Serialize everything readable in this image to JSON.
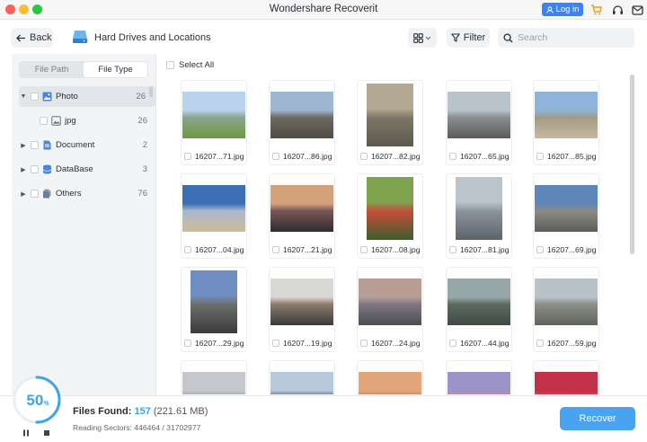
{
  "window": {
    "title": "Wondershare Recoverit",
    "login_label": "Log in"
  },
  "header": {
    "back_label": "Back",
    "location_title": "Hard Drives and Locations",
    "filter_label": "Filter",
    "search_placeholder": "Search"
  },
  "sidebar": {
    "tabs": [
      {
        "label": "File Path",
        "active": false
      },
      {
        "label": "File Type",
        "active": true
      }
    ],
    "items": [
      {
        "label": "Photo",
        "count": "26",
        "icon": "photo-icon",
        "color": "#4a86d8"
      },
      {
        "label": "jpg",
        "count": "26",
        "icon": "image-file-icon",
        "color": "#8a8f97"
      },
      {
        "label": "Document",
        "count": "2",
        "icon": "document-icon",
        "color": "#4a86d8"
      },
      {
        "label": "DataBase",
        "count": "3",
        "icon": "database-icon",
        "color": "#4a86d8"
      },
      {
        "label": "Others",
        "count": "76",
        "icon": "others-icon",
        "color": "#6b7f99"
      }
    ]
  },
  "content": {
    "select_all_label": "Select All",
    "files": [
      {
        "name": "16207...71.jpg",
        "orientation": "landscape",
        "colors": [
          "#b9d2ee",
          "#8aa58a",
          "#6c9a3f"
        ]
      },
      {
        "name": "16207...86.jpg",
        "orientation": "landscape",
        "colors": [
          "#9eb6cf",
          "#6e6a62",
          "#4f4a44"
        ]
      },
      {
        "name": "16207...82.jpg",
        "orientation": "portrait",
        "colors": [
          "#b3a892",
          "#7d7566",
          "#5e5a50"
        ]
      },
      {
        "name": "16207...65.jpg",
        "orientation": "landscape",
        "colors": [
          "#b9c3cc",
          "#8a8f93",
          "#5b5b58"
        ]
      },
      {
        "name": "16207...85.jpg",
        "orientation": "landscape",
        "colors": [
          "#8fb3d9",
          "#a39a86",
          "#c9b9a0"
        ]
      },
      {
        "name": "16207...04.jpg",
        "orientation": "landscape",
        "colors": [
          "#3a6fb3",
          "#a7b8cf",
          "#d1bb94"
        ]
      },
      {
        "name": "16207...21.jpg",
        "orientation": "landscape",
        "colors": [
          "#d4a27a",
          "#7a5757",
          "#2f2b31"
        ]
      },
      {
        "name": "16207...08.jpg",
        "orientation": "portrait",
        "colors": [
          "#7fa24f",
          "#c44c3a",
          "#3d5e2c"
        ]
      },
      {
        "name": "16207...81.jpg",
        "orientation": "portrait",
        "colors": [
          "#bcc4cb",
          "#8b939a",
          "#5d6369"
        ]
      },
      {
        "name": "16207...69.jpg",
        "orientation": "landscape",
        "colors": [
          "#5f86b8",
          "#8c8b85",
          "#5a5d58"
        ]
      },
      {
        "name": "16207...29.jpg",
        "orientation": "portrait",
        "colors": [
          "#6f8fc2",
          "#6a6d6a",
          "#3a3b3a"
        ]
      },
      {
        "name": "16207...19.jpg",
        "orientation": "landscape",
        "colors": [
          "#d8d7d3",
          "#8b7b6b",
          "#3c3a38"
        ]
      },
      {
        "name": "16207...24.jpg",
        "orientation": "landscape",
        "colors": [
          "#b79d93",
          "#7e7883",
          "#4d4b50"
        ]
      },
      {
        "name": "16207...44.jpg",
        "orientation": "landscape",
        "colors": [
          "#97a7a8",
          "#5d6a61",
          "#414a44"
        ]
      },
      {
        "name": "16207...59.jpg",
        "orientation": "landscape",
        "colors": [
          "#b9c2c9",
          "#8c8f88",
          "#5f645c"
        ]
      },
      {
        "name": "",
        "orientation": "landscape",
        "colors": [
          "#c4c8cc",
          "#9a9a92",
          "#6e6e68"
        ]
      },
      {
        "name": "",
        "orientation": "landscape",
        "colors": [
          "#b8c9dd",
          "#4a5a72",
          "#1f2530"
        ]
      },
      {
        "name": "",
        "orientation": "landscape",
        "colors": [
          "#e3a67b",
          "#c1756a",
          "#6a4a58"
        ]
      },
      {
        "name": "",
        "orientation": "landscape",
        "colors": [
          "#9b93c7",
          "#cf8a8b",
          "#7a6a86"
        ]
      },
      {
        "name": "",
        "orientation": "landscape",
        "colors": [
          "#c2304a",
          "#e04b4f",
          "#3e5b2f"
        ]
      }
    ]
  },
  "footer": {
    "progress": "50",
    "progress_fraction": 0.5,
    "progress_unit": "%",
    "files_found_label": "Files Found:",
    "files_found_count": "157",
    "files_found_size": "(221.61 MB)",
    "reading_sectors": "Reading Sectors: 446464 / 31702977",
    "recover_label": "Recover",
    "accent_color": "#3ba6e6"
  }
}
